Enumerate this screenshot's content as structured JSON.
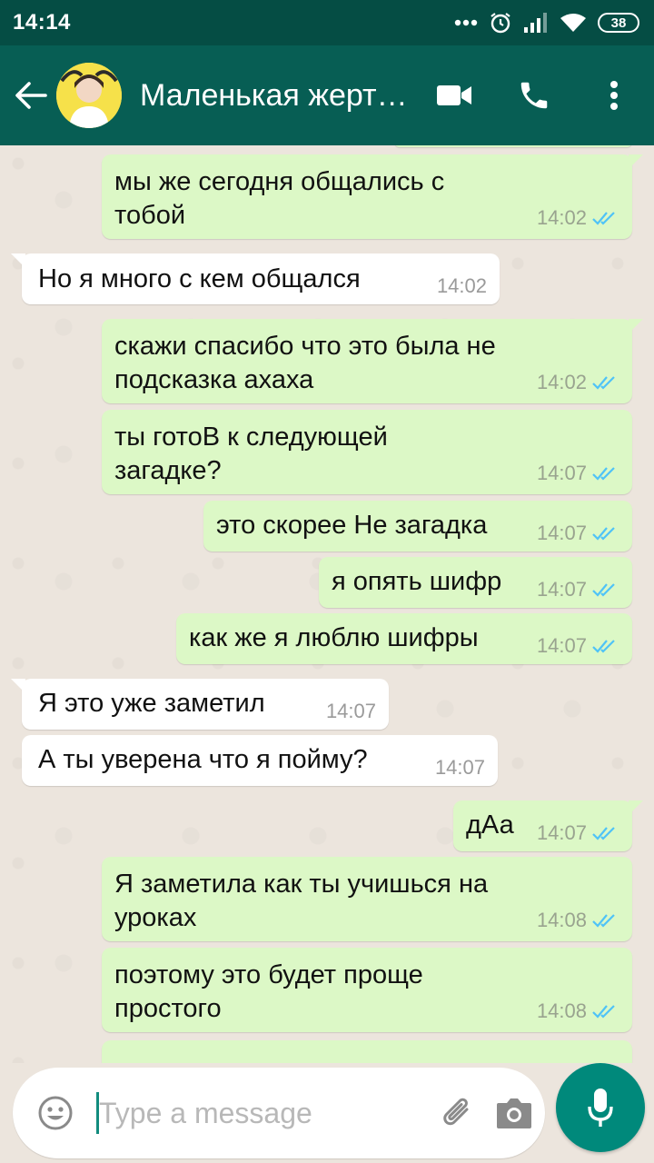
{
  "status_bar": {
    "time": "14:14",
    "battery": "38"
  },
  "header": {
    "contact_name": "Маленькая жерт…",
    "colors": {
      "toolbar": "#075e54",
      "status_bar": "#054d44"
    }
  },
  "messages": [
    {
      "dir": "out",
      "lines": [
        "мы же сегодня общались с",
        "тобой"
      ],
      "time": "14:02",
      "status": "read"
    },
    {
      "dir": "in",
      "lines": [
        "Но я много с кем общался"
      ],
      "time": "14:02"
    },
    {
      "dir": "out",
      "lines": [
        "скажи спасибо что это была не",
        "подсказка ахаха"
      ],
      "time": "14:02",
      "status": "read"
    },
    {
      "dir": "out",
      "lines": [
        "ты готоВ к следующей",
        "загадке?"
      ],
      "time": "14:07",
      "status": "read"
    },
    {
      "dir": "out",
      "lines": [
        "это скорее Не загадка"
      ],
      "time": "14:07",
      "status": "read"
    },
    {
      "dir": "out",
      "lines": [
        "я опять шифр"
      ],
      "time": "14:07",
      "status": "read"
    },
    {
      "dir": "out",
      "lines": [
        "как же я люблю шифры"
      ],
      "time": "14:07",
      "status": "read"
    },
    {
      "dir": "in",
      "lines": [
        "Я это уже заметил"
      ],
      "time": "14:07"
    },
    {
      "dir": "in",
      "lines": [
        "А ты уверена что я пойму?"
      ],
      "time": "14:07"
    },
    {
      "dir": "out",
      "lines": [
        "дАа"
      ],
      "time": "14:07",
      "status": "read"
    },
    {
      "dir": "out",
      "lines": [
        "Я заметила как ты учишься на",
        "уроках"
      ],
      "time": "14:08",
      "status": "read"
    },
    {
      "dir": "out",
      "lines": [
        "поэтому это будет проще",
        "простого"
      ],
      "time": "14:08",
      "status": "read"
    }
  ],
  "input": {
    "placeholder": "Type a message"
  },
  "colors": {
    "outgoing_bubble": "#dcf8c6",
    "incoming_bubble": "#ffffff",
    "read_ticks": "#4fc3f7",
    "mic_button": "#00897b"
  }
}
